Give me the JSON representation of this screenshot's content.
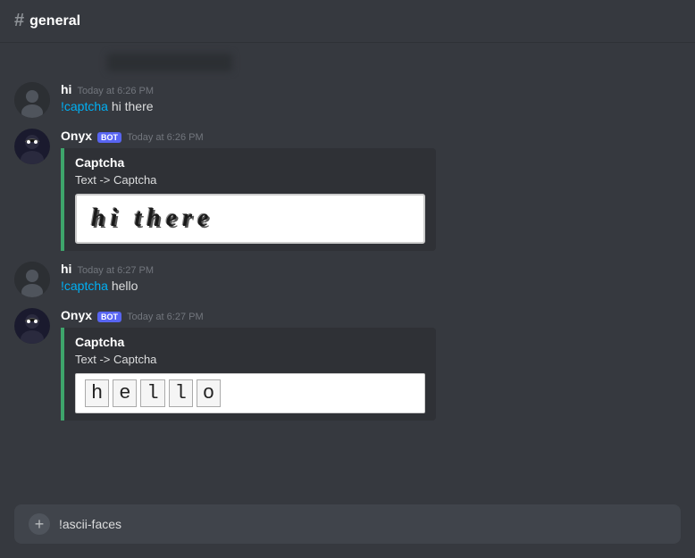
{
  "header": {
    "hash": "#",
    "channel_name": "general"
  },
  "messages": [
    {
      "id": "blurred",
      "type": "blurred"
    },
    {
      "id": "msg1",
      "type": "user",
      "username": "hi",
      "timestamp": "Today at 6:26 PM",
      "text_prefix": "!captcha ",
      "text_command": "hi there"
    },
    {
      "id": "msg2",
      "type": "bot",
      "username": "Onyx",
      "is_bot": true,
      "bot_badge": "BOT",
      "timestamp": "Today at 6:26 PM",
      "embed": {
        "title": "Captcha",
        "field": "Text -> Captcha",
        "captcha_text": "hi there",
        "captcha_type": "hi_there"
      }
    },
    {
      "id": "msg3",
      "type": "user",
      "username": "hi",
      "timestamp": "Today at 6:27 PM",
      "text_prefix": "!captcha ",
      "text_command": "hello"
    },
    {
      "id": "msg4",
      "type": "bot",
      "username": "Onyx",
      "is_bot": true,
      "bot_badge": "BOT",
      "timestamp": "Today at 6:27 PM",
      "embed": {
        "title": "Captcha",
        "field": "Text -> Captcha",
        "captcha_text": "hello",
        "captcha_type": "hello",
        "letters": [
          "h",
          "e",
          "l",
          "l",
          "o"
        ]
      }
    }
  ],
  "input": {
    "placeholder": "!ascii-faces"
  },
  "colors": {
    "embed_border": "#3ea56b",
    "bot_badge": "#5865f2",
    "command_color": "#00b0f4"
  }
}
